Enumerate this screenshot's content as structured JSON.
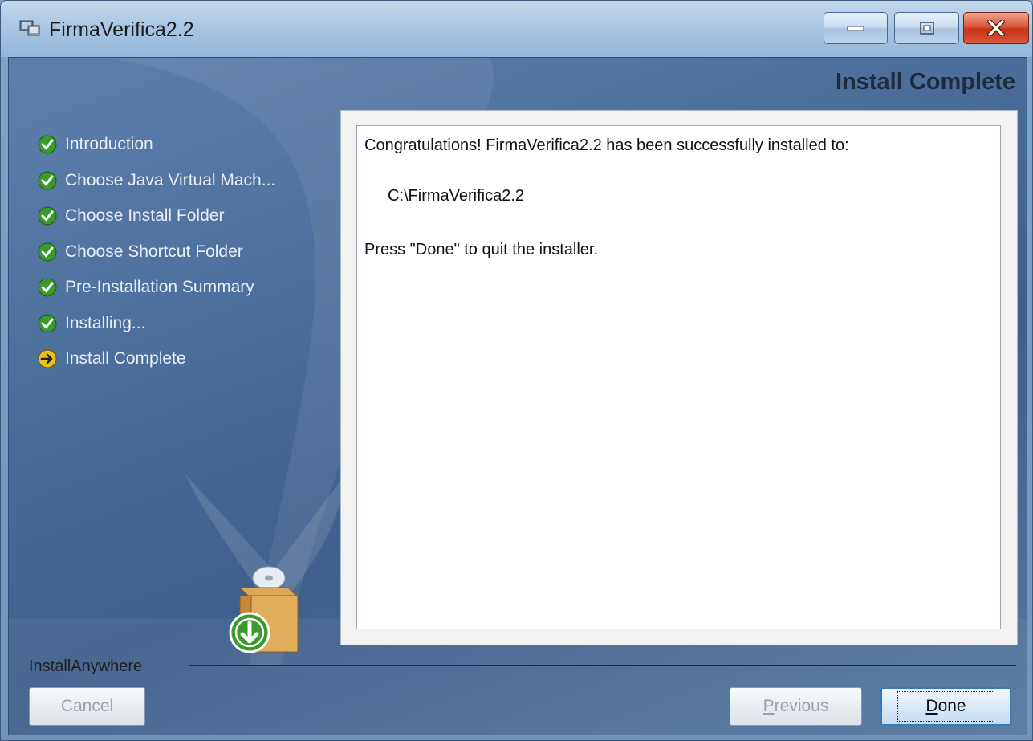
{
  "window": {
    "title": "FirmaVerifica2.2",
    "controls": [
      "minimize",
      "maximize",
      "close"
    ]
  },
  "header": {
    "title": "Install Complete"
  },
  "steps": [
    {
      "label": "Introduction",
      "status": "done"
    },
    {
      "label": "Choose Java Virtual Mach...",
      "status": "done"
    },
    {
      "label": "Choose Install Folder",
      "status": "done"
    },
    {
      "label": "Choose Shortcut Folder",
      "status": "done"
    },
    {
      "label": "Pre-Installation Summary",
      "status": "done"
    },
    {
      "label": "Installing...",
      "status": "done"
    },
    {
      "label": "Install Complete",
      "status": "current"
    }
  ],
  "content": {
    "message": "Congratulations! FirmaVerifica2.2 has been successfully installed to:",
    "install_path": "C:\\FirmaVerifica2.2",
    "instruction": "Press \"Done\" to quit the installer."
  },
  "footer": {
    "brand": "InstallAnywhere",
    "cancel_label": "Cancel",
    "previous_label_mnemonic": "P",
    "previous_label_rest": "revious",
    "done_label_mnemonic": "D",
    "done_label_rest": "one"
  },
  "colors": {
    "done_icon": "#3a9a2a",
    "current_icon": "#e8c21a",
    "close_button": "#c43416"
  }
}
